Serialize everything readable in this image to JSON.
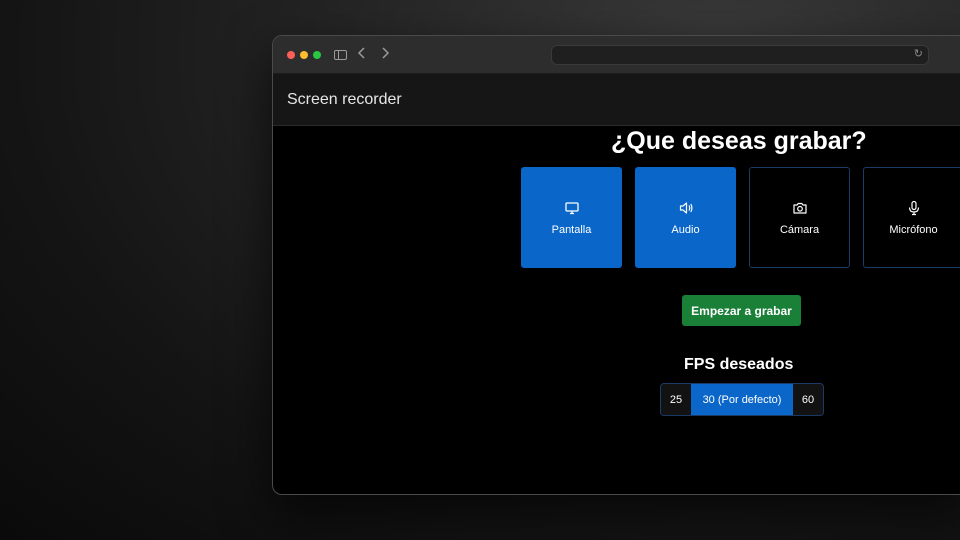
{
  "app": {
    "title": "Screen recorder"
  },
  "main": {
    "heading": "¿Que deseas grabar?",
    "options": [
      {
        "label": "Pantalla",
        "icon": "monitor-icon",
        "selected": true
      },
      {
        "label": "Audio",
        "icon": "speaker-icon",
        "selected": true
      },
      {
        "label": "Cámara",
        "icon": "camera-icon",
        "selected": false
      },
      {
        "label": "Micrófono",
        "icon": "microphone-icon",
        "selected": false
      }
    ],
    "start_button": "Empezar a grabar",
    "fps_label": "FPS deseados",
    "fps_options": [
      {
        "label": "25",
        "selected": false
      },
      {
        "label": "30 (Por defecto)",
        "selected": true
      },
      {
        "label": "60",
        "selected": false
      }
    ]
  },
  "colors": {
    "accent": "#0a66c8",
    "success": "#1a8038",
    "background": "#000000"
  }
}
